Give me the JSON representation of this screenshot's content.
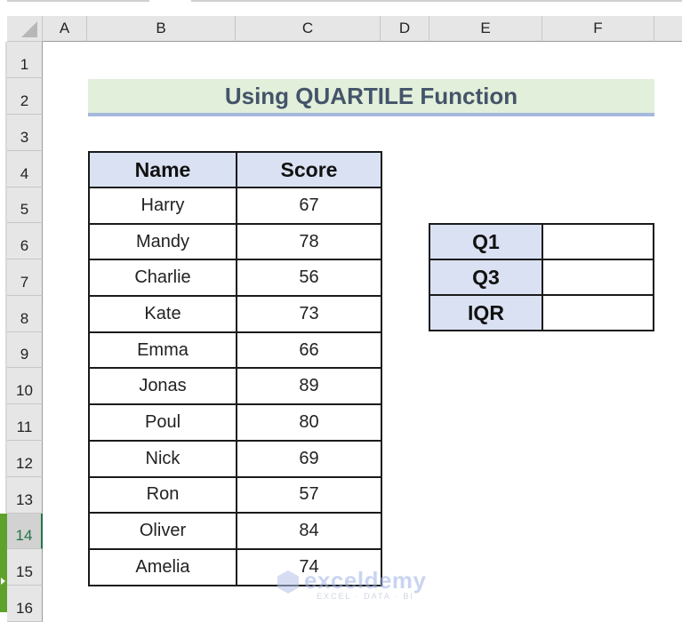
{
  "sheet": {
    "columns": [
      "A",
      "B",
      "C",
      "D",
      "E",
      "F"
    ],
    "rows": [
      "1",
      "2",
      "3",
      "4",
      "5",
      "6",
      "7",
      "8",
      "9",
      "10",
      "11",
      "12",
      "13",
      "14",
      "15",
      "16"
    ],
    "selected_row": "14"
  },
  "title": "Using QUARTILE Function",
  "table": {
    "headers": [
      "Name",
      "Score"
    ],
    "rows": [
      {
        "name": "Harry",
        "score": "67"
      },
      {
        "name": "Mandy",
        "score": "78"
      },
      {
        "name": "Charlie",
        "score": "56"
      },
      {
        "name": "Kate",
        "score": "73"
      },
      {
        "name": "Emma",
        "score": "66"
      },
      {
        "name": "Jonas",
        "score": "89"
      },
      {
        "name": "Poul",
        "score": "80"
      },
      {
        "name": "Nick",
        "score": "69"
      },
      {
        "name": "Ron",
        "score": "57"
      },
      {
        "name": "Oliver",
        "score": "84"
      },
      {
        "name": "Amelia",
        "score": "74"
      }
    ]
  },
  "quartiles": [
    {
      "label": "Q1",
      "value": ""
    },
    {
      "label": "Q3",
      "value": ""
    },
    {
      "label": "IQR",
      "value": ""
    }
  ],
  "watermark": {
    "name": "exceldemy",
    "tagline": "EXCEL · DATA · BI"
  }
}
